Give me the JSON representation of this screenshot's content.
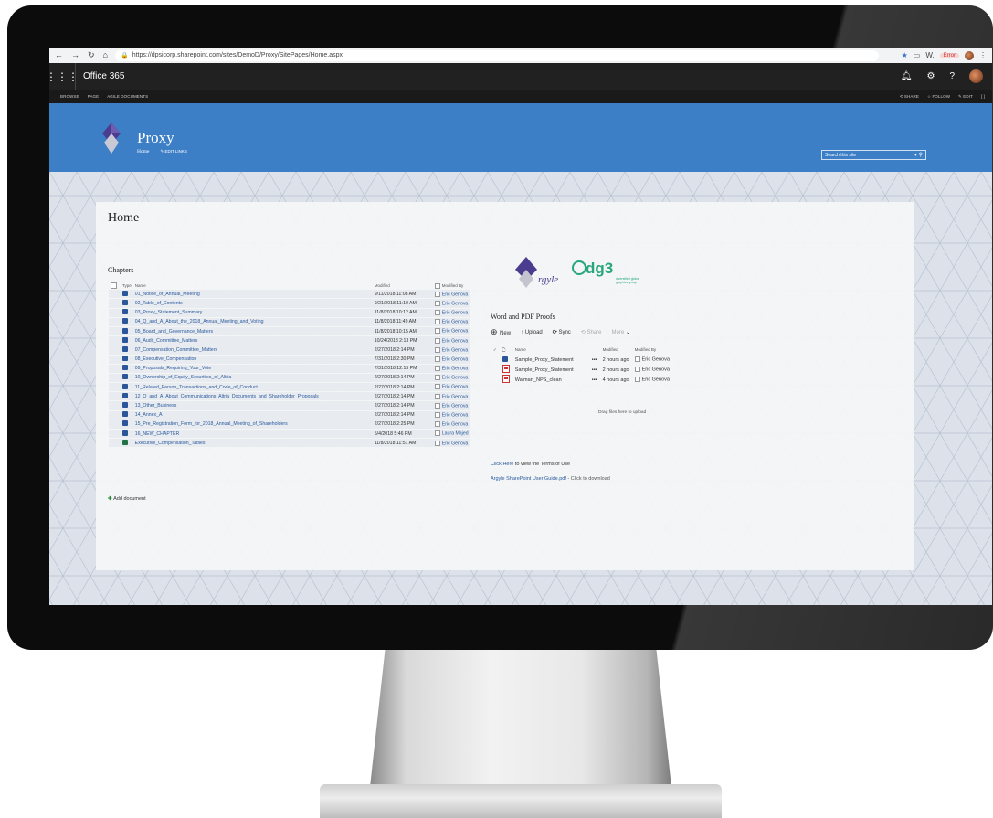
{
  "browser": {
    "url": "https://dpsicorp.sharepoint.com/sites/DemoD/Proxy/SitePages/Home.aspx",
    "error_label": "Error",
    "ext_label": "W."
  },
  "suite": {
    "brand": "Office 365"
  },
  "ribbon": {
    "tabs": [
      "BROWSE",
      "PAGE",
      "AGILE DOCUMENTS"
    ],
    "actions": [
      "SHARE",
      "FOLLOW",
      "EDIT"
    ]
  },
  "site": {
    "title": "Proxy",
    "nav_home": "Home",
    "edit_links": "EDIT LINKS",
    "search_placeholder": "Search this site"
  },
  "page": {
    "title": "Home"
  },
  "chapters": {
    "title": "Chapters",
    "headers": {
      "type": "Type",
      "name": "Name",
      "modified": "Modified",
      "modified_by": "Modified By"
    },
    "rows": [
      {
        "name": "01_Notice_of_Annual_Meeting",
        "modified": "9/11/2018 11:08 AM",
        "by": "Eric Genova",
        "icon": "word-doc-icon"
      },
      {
        "name": "02_Table_of_Contents",
        "modified": "9/21/2018 11:10 AM",
        "by": "Eric Genova",
        "icon": "word-doc-icon"
      },
      {
        "name": "03_Proxy_Statement_Summary",
        "modified": "11/8/2018 10:12 AM",
        "by": "Eric Genova",
        "icon": "word-doc-icon"
      },
      {
        "name": "04_Q_and_A_About_the_2018_Annual_Meeting_and_Voting",
        "modified": "11/8/2018 11:49 AM",
        "by": "Eric Genova",
        "icon": "word-doc-icon"
      },
      {
        "name": "05_Board_and_Governance_Matters",
        "modified": "11/8/2018 10:15 AM",
        "by": "Eric Genova",
        "icon": "word-doc-icon"
      },
      {
        "name": "06_Audit_Committee_Matters",
        "modified": "10/24/2018 2:13 PM",
        "by": "Eric Genova",
        "icon": "word-doc-icon"
      },
      {
        "name": "07_Compensation_Committee_Matters",
        "modified": "2/27/2018 2:14 PM",
        "by": "Eric Genova",
        "icon": "word-doc-icon"
      },
      {
        "name": "08_Executive_Compensation",
        "modified": "7/31/2018 2:30 PM",
        "by": "Eric Genova",
        "icon": "word-doc-icon"
      },
      {
        "name": "09_Proposals_Requiring_Your_Vote",
        "modified": "7/31/2018 12:15 PM",
        "by": "Eric Genova",
        "icon": "word-doc-icon"
      },
      {
        "name": "10_Ownership_of_Equity_Securities_of_Altria",
        "modified": "2/27/2018 2:14 PM",
        "by": "Eric Genova",
        "icon": "word-doc-icon"
      },
      {
        "name": "11_Related_Person_Transactions_and_Code_of_Conduct",
        "modified": "2/27/2018 2:14 PM",
        "by": "Eric Genova",
        "icon": "word-doc-icon"
      },
      {
        "name": "12_Q_and_A_About_Communications_Altria_Documents_and_Shareholder_Proposals",
        "modified": "2/27/2018 2:14 PM",
        "by": "Eric Genova",
        "icon": "word-doc-icon"
      },
      {
        "name": "13_Other_Business",
        "modified": "2/27/2018 2:14 PM",
        "by": "Eric Genova",
        "icon": "word-doc-icon"
      },
      {
        "name": "14_Annex_A",
        "modified": "2/27/2018 2:14 PM",
        "by": "Eric Genova",
        "icon": "word-doc-icon"
      },
      {
        "name": "15_Pre_Registration_Form_for_2018_Annual_Meeting_of_Shareholders",
        "modified": "2/27/2018 2:25 PM",
        "by": "Eric Genova",
        "icon": "word-doc-icon"
      },
      {
        "name": "16_NEW_CHAPTER",
        "modified": "5/4/2018 5:46 PM",
        "by": "Laura Majed",
        "icon": "word-doc-icon"
      },
      {
        "name": "Executive_Compensation_Tables",
        "modified": "11/8/2018 11:51 AM",
        "by": "Eric Genova",
        "icon": "excel-doc-icon"
      }
    ],
    "add_document": "Add document"
  },
  "logos": {
    "argyle": "Argyle",
    "dg3": "dg3",
    "dg3_tagline": "diversified global graphics group"
  },
  "proofs": {
    "title": "Word and PDF Proofs",
    "commands": {
      "new": "New",
      "upload": "Upload",
      "sync": "Sync",
      "share": "Share",
      "more": "More"
    },
    "headers": {
      "name": "Name",
      "modified": "Modified",
      "modified_by": "Modified By"
    },
    "rows": [
      {
        "name": "Sample_Proxy_Statement",
        "modified": "2 hours ago",
        "by": "Eric Genova",
        "icon": "word-doc-icon"
      },
      {
        "name": "Sample_Proxy_Statement",
        "modified": "2 hours ago",
        "by": "Eric Genova",
        "icon": "pdf-doc-icon"
      },
      {
        "name": "Walmart_NPS_clean",
        "modified": "4 hours ago",
        "by": "Eric Genova",
        "icon": "pdf-doc-icon"
      }
    ],
    "drag_hint": "Drag files here to upload"
  },
  "links": {
    "terms_link": "Click Here",
    "terms_text": " to view the Terms of Use",
    "guide_link": "Argyle SharePoint User Guide.pdf",
    "guide_text": " - Click to download"
  },
  "colors": {
    "suite_bar": "#212121",
    "header_blue": "#3c7fc7",
    "link_blue": "#2a5a9e"
  }
}
